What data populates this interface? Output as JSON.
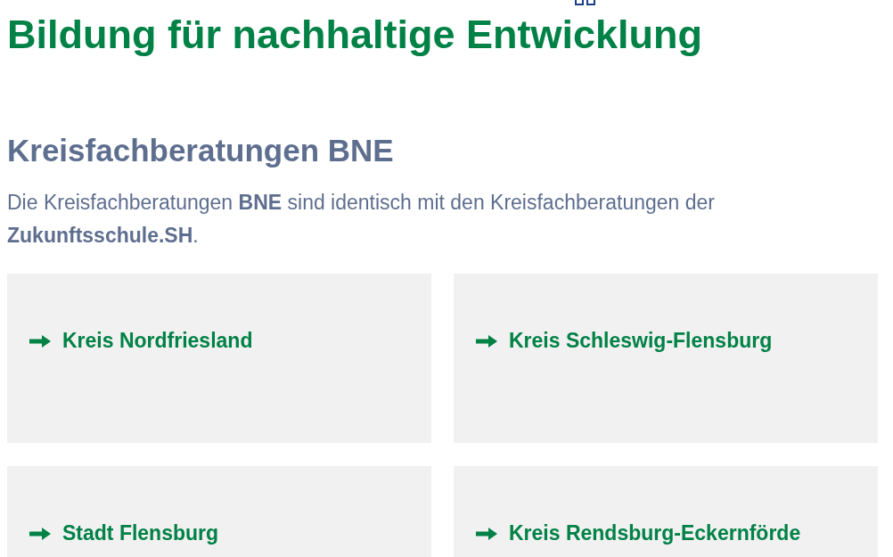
{
  "page_title": "Bildung für nachhaltige Entwicklung",
  "section": {
    "heading": "Kreisfachberatungen BNE",
    "intro": "Die Kreisfachberatungen **BNE** sind identisch mit den Kreisfachberatungen der **Zukunftsschule.SH**."
  },
  "links": [
    {
      "label": "Kreis Nordfriesland"
    },
    {
      "label": "Kreis Schleswig-Flensburg"
    },
    {
      "label": "Stadt Flensburg"
    },
    {
      "label": "Kreis Rendsburg-Eckernförde"
    }
  ]
}
